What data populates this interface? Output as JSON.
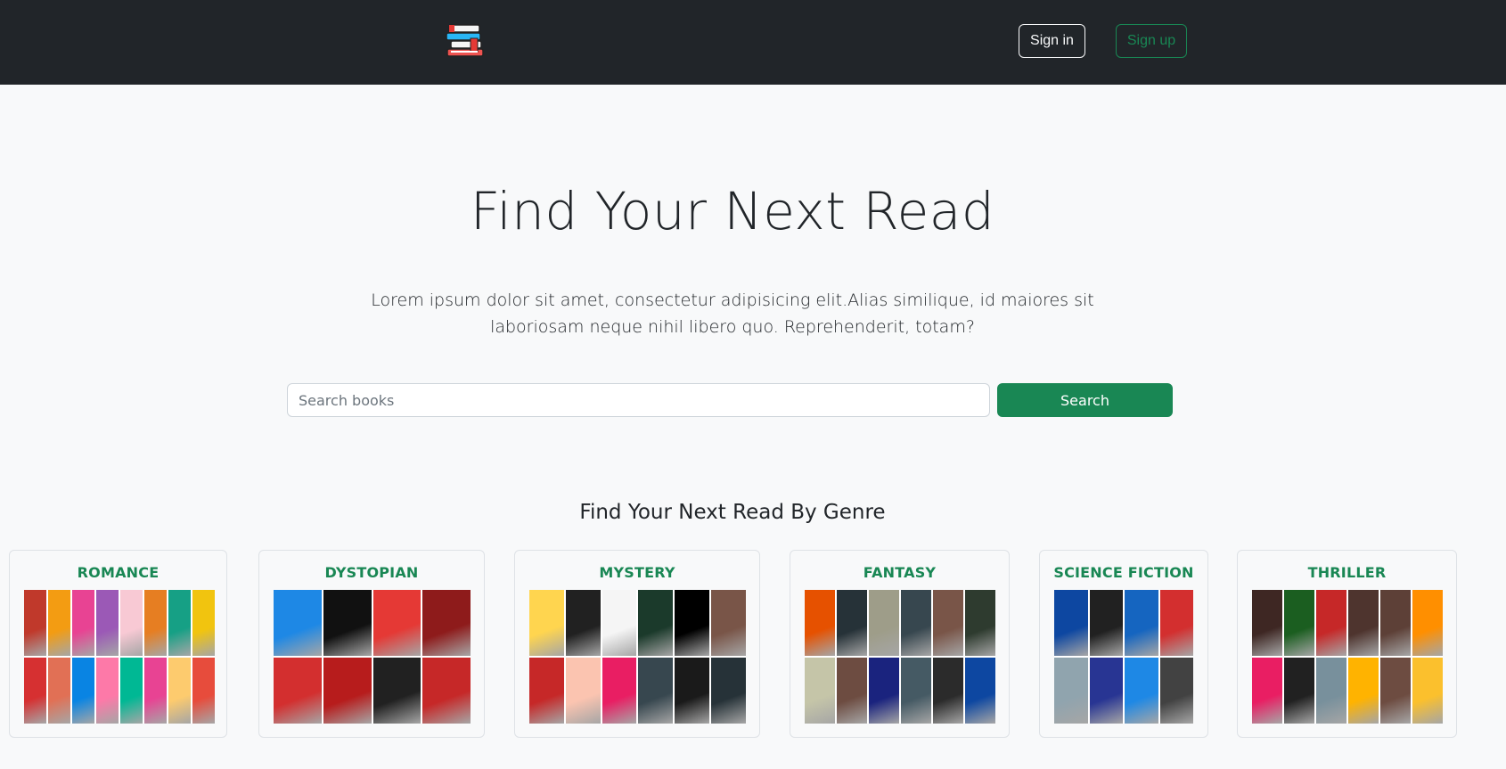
{
  "navbar": {
    "logo_icon": "books-stack-icon",
    "signin_label": "Sign in",
    "signup_label": "Sign up"
  },
  "hero": {
    "title": "Find Your Next Read",
    "lead": "Lorem ipsum dolor sit amet, consectetur adipisicing elit.Alias similique, id maiores sit laboriosam neque nihil libero quo. Reprehenderit, totam?"
  },
  "search": {
    "placeholder": "Search books",
    "value": "",
    "button_label": "Search"
  },
  "genres": {
    "heading": "Find Your Next Read By Genre",
    "items": [
      {
        "title": "ROMANCE",
        "colors": [
          "#c0392b",
          "#f39c12",
          "#e84393",
          "#9b59b6",
          "#f8c9d4",
          "#e67e22",
          "#16a085",
          "#f1c40f",
          "#d63031",
          "#e17055",
          "#0984e3",
          "#fd79a8",
          "#00b894",
          "#e84393",
          "#fdcb6e",
          "#e74c3c"
        ]
      },
      {
        "title": "DYSTOPIAN",
        "colors": [
          "#1e88e5",
          "#111111",
          "#e53935",
          "#8e1b1b",
          "#d32f2f",
          "#b71c1c",
          "#212121",
          "#c62828"
        ]
      },
      {
        "title": "MYSTERY",
        "colors": [
          "#ffd54f",
          "#212121",
          "#f5f5f5",
          "#1b3a2b",
          "#000000",
          "#795548",
          "#c62828",
          "#fbc4b0",
          "#e91e63",
          "#37474f",
          "#1a1a1a",
          "#263238"
        ]
      },
      {
        "title": "FANTASY",
        "colors": [
          "#e65100",
          "#263238",
          "#9e9d89",
          "#37474f",
          "#795548",
          "#2e3b2f",
          "#c5c5a8",
          "#6d4c41",
          "#1a237e",
          "#455a64",
          "#2b2b2b",
          "#0d47a1"
        ]
      },
      {
        "title": "SCIENCE FICTION",
        "colors": [
          "#0d47a1",
          "#212121",
          "#1565c0",
          "#d32f2f",
          "#90a4ae",
          "#283593",
          "#1e88e5",
          "#424242"
        ]
      },
      {
        "title": "THRILLER",
        "colors": [
          "#3e2723",
          "#1b5e20",
          "#c62828",
          "#4e342e",
          "#5d4037",
          "#ff8f00",
          "#e91e63",
          "#212121",
          "#78909c",
          "#ffb300",
          "#6d4c41",
          "#fbc02d"
        ]
      }
    ]
  }
}
